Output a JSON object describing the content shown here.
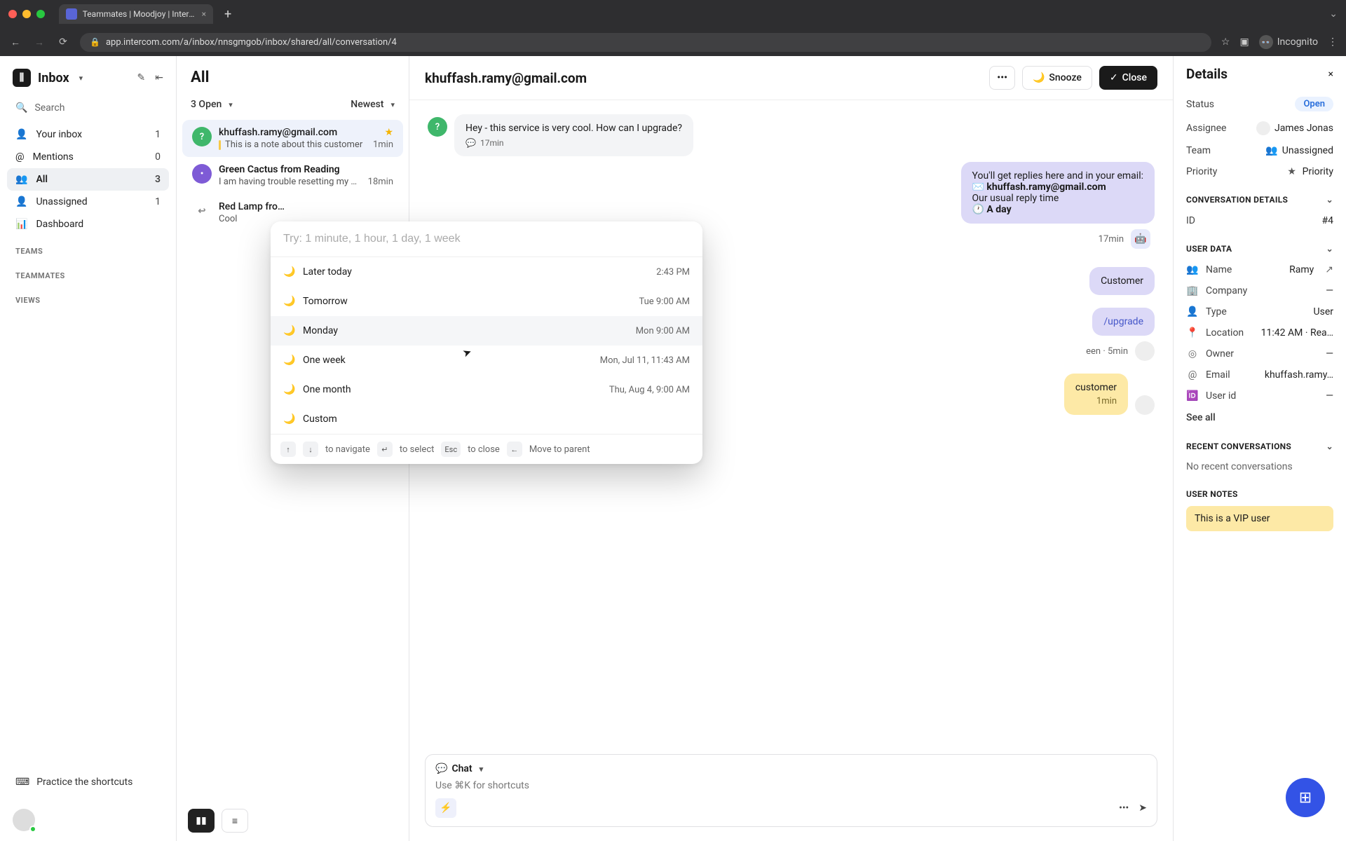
{
  "browser": {
    "tab_title": "Teammates | Moodjoy | Interco",
    "url": "app.intercom.com/a/inbox/nnsgmgob/inbox/shared/all/conversation/4",
    "incognito_label": "Incognito"
  },
  "sidebar": {
    "title": "Inbox",
    "search_label": "Search",
    "items": [
      {
        "icon": "user",
        "label": "Your inbox",
        "count": "1"
      },
      {
        "icon": "at",
        "label": "Mentions",
        "count": "0"
      },
      {
        "icon": "users",
        "label": "All",
        "count": "3",
        "active": true
      },
      {
        "icon": "user-x",
        "label": "Unassigned",
        "count": "1"
      },
      {
        "icon": "chart",
        "label": "Dashboard",
        "count": ""
      }
    ],
    "sections": {
      "teams": "TEAMS",
      "teammates": "TEAMMATES",
      "views": "VIEWS"
    },
    "shortcuts_label": "Practice the shortcuts"
  },
  "convlist": {
    "title": "All",
    "open_filter": "3 Open",
    "sort": "Newest",
    "items": [
      {
        "sender": "khuffash.ramy@gmail.com",
        "preview": "This is a note about this customer",
        "time": "1min",
        "starred": true,
        "note": true,
        "avatar_bg": "#3fb76b",
        "avatar_txt": "?",
        "active": true
      },
      {
        "sender": "Green Cactus from Reading",
        "preview": "I am having trouble resetting my …",
        "time": "18min",
        "avatar_bg": "#7e5bd6",
        "avatar_txt": "•"
      },
      {
        "sender": "Red Lamp fro…",
        "preview": "Cool",
        "time": "",
        "reply": true,
        "avatar_bg": "#e6e6e9",
        "avatar_txt": ""
      }
    ]
  },
  "conversation": {
    "title": "khuffash.ramy@gmail.com",
    "snooze_btn": "Snooze",
    "close_btn": "Close",
    "messages": {
      "first_text": "Hey - this service is very cool. How can I upgrade?",
      "first_meta": "17min",
      "auto_intro_1": "You'll get replies here and in your email:",
      "auto_email": "khuffash.ramy@gmail.com",
      "auto_intro_2": "Our usual reply time",
      "auto_time": "🕐 A day",
      "auto_meta": "17min",
      "cust_partial": "Customer",
      "upgrade_partial": "/upgrade",
      "seen_meta": "een · 5min",
      "note_partial": "customer",
      "note_time": "1min"
    },
    "composer": {
      "mode": "Chat",
      "placeholder": "Use ⌘K for shortcuts"
    }
  },
  "snooze": {
    "placeholder": "Try: 1 minute, 1 hour, 1 day, 1 week",
    "options": [
      {
        "label": "Later today",
        "time": "2:43 PM"
      },
      {
        "label": "Tomorrow",
        "time": "Tue 9:00 AM"
      },
      {
        "label": "Monday",
        "time": "Mon 9:00 AM",
        "hover": true
      },
      {
        "label": "One week",
        "time": "Mon, Jul 11, 11:43 AM"
      },
      {
        "label": "One month",
        "time": "Thu, Aug 4, 9:00 AM"
      },
      {
        "label": "Custom",
        "time": ""
      }
    ],
    "hint_navigate": "to navigate",
    "hint_select": "to select",
    "hint_close": "to close",
    "hint_parent": "Move to parent",
    "esc_key": "Esc"
  },
  "details": {
    "title": "Details",
    "props": {
      "status_label": "Status",
      "status_val": "Open",
      "assignee_label": "Assignee",
      "assignee_val": "James Jonas",
      "team_label": "Team",
      "team_val": "Unassigned",
      "priority_label": "Priority",
      "priority_val": "Priority"
    },
    "conv_section": "CONVERSATION DETAILS",
    "id_label": "ID",
    "id_val": "#4",
    "user_section": "USER DATA",
    "user_rows": [
      {
        "icon": "👥",
        "label": "Name",
        "val": "Ramy",
        "ext": true
      },
      {
        "icon": "🏢",
        "label": "Company",
        "val": "—"
      },
      {
        "icon": "👤",
        "label": "Type",
        "val": "User"
      },
      {
        "icon": "📍",
        "label": "Location",
        "val": "11:42 AM · Rea…"
      },
      {
        "icon": "◎",
        "label": "Owner",
        "val": "—"
      },
      {
        "icon": "@",
        "label": "Email",
        "val": "khuffash.ramy…"
      },
      {
        "icon": "🆔",
        "label": "User id",
        "val": "—"
      }
    ],
    "see_all": "See all",
    "recent_section": "RECENT CONVERSATIONS",
    "recent_empty": "No recent conversations",
    "notes_section": "USER NOTES",
    "notes_body": "This is a VIP user"
  }
}
